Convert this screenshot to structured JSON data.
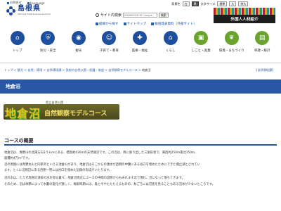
{
  "utility": {
    "sitemap": "お問合せ",
    "language": "Language"
  },
  "site": {
    "name": "島根県",
    "name_en": "Shimane Prefectural Government"
  },
  "header": {
    "bg_label": "背景色",
    "bg_white": "白",
    "bg_black": "黒",
    "text_size": "文字サイズ",
    "size_std": "標準",
    "size_large": "大",
    "size_xl": "特大"
  },
  "search": {
    "label": "サイト内検索",
    "placeholder": "ENHANCED BY Google",
    "button": "検索"
  },
  "quick_links": [
    "組織から探す",
    "サイトマップ",
    "報道発表資料（外部サイト）"
  ],
  "banner": {
    "text": "外国人人材紹介"
  },
  "nav": [
    {
      "label": "トップ",
      "color": "blue"
    },
    {
      "label": "防災・安全",
      "color": "blue"
    },
    {
      "label": "観光",
      "color": "blue"
    },
    {
      "label": "子育て・教育",
      "color": "blue"
    },
    {
      "label": "医療・福祉",
      "color": "blue"
    },
    {
      "label": "くらし",
      "color": "blue"
    },
    {
      "label": "しごと・産業",
      "color": "green"
    },
    {
      "label": "環境・まちづくり",
      "color": "green"
    },
    {
      "label": "県政・統計",
      "color": "green"
    }
  ],
  "breadcrumb": [
    "トップ",
    "観光",
    "自然・環境",
    "自然環境課",
    "島根の自然公園・保護・施設",
    "自然観察モデルコース",
    "地倉沼"
  ],
  "breadcrumb_right": "【自然環境課】",
  "page_title": "地倉沼",
  "hero": {
    "park": "県立自然公園",
    "main": "地倉沼",
    "sub": "自然観察モデルコース"
  },
  "section_title": "コースの概要",
  "paragraphs": [
    "地倉沼は、青野山の北東方向3.5ｋｍにある、標高約430mの天然湖沼です。この沼は、両に張り出した三角形状で、東西約250m南北150m、",
    "面積約4万ｍ²です。",
    "沼の周囲には青野丸山と同系列といえる池倉山があり、地倉沼はそこからの湧水が西側の中腹にある谷口を埋めたためにできた堰止湖とされてい",
    "ます。とくに沼周辺にある西側一帯には谷口を埋めた記録の形成がいたります。",
    "沼の水は、たえず周囲の湧泉の水を得る裏々、地倉沼周辺にユースの中間の説明からもみれます北で現れ、沼になって落ちてきます。",
    "そのため、沼は季節によって水量の変化が激しく、梅雨時期には、奥と今やたたたえるものの、秋ごろには沼底を見ることもある沼水が少ないところです。"
  ]
}
